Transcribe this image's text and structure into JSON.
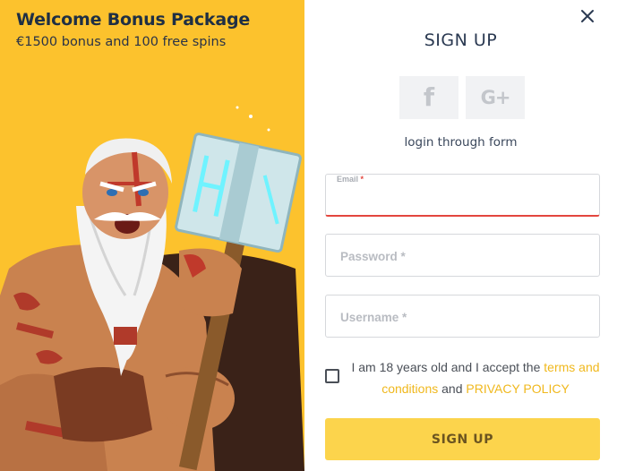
{
  "promo": {
    "title": "Welcome Bonus Package",
    "subtitle": "€1500 bonus and 100 free spins"
  },
  "form": {
    "title": "SIGN UP",
    "social": [
      {
        "name": "facebook",
        "glyph": "f",
        "icon": "facebook-icon"
      },
      {
        "name": "google-plus",
        "glyph": "G+",
        "icon": "google-plus-icon"
      }
    ],
    "login_through_form": "login through form",
    "email": {
      "label": "Email",
      "required_mark": "*",
      "value": ""
    },
    "password": {
      "placeholder": "Password *",
      "value": ""
    },
    "username": {
      "placeholder": "Username *",
      "value": ""
    },
    "terms": {
      "text_before": "I am 18 years old and I accept the",
      "terms_link": "terms and conditions",
      "and": "and",
      "privacy_link": "PRIVACY POLICY"
    },
    "submit_label": "SIGN UP",
    "close_icon": "close-icon"
  },
  "colors": {
    "promo_bg": "#fcc22d",
    "accent": "#fcd44c",
    "link": "#f0b81d",
    "error_underline": "#e3463e",
    "title_text": "#1f2f44"
  },
  "hero_image": "bearded-warrior-with-hammer"
}
